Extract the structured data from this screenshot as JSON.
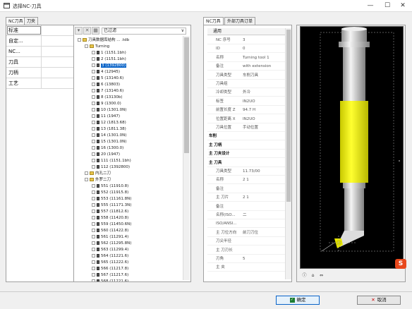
{
  "window": {
    "title": "选择NC-刀具",
    "minimize": "—",
    "maximize": "☐",
    "close": "✕"
  },
  "left_tabs": [
    "NC刀具",
    "刀夹"
  ],
  "left_list": [
    "标准",
    "自定...",
    "NC...",
    "刀具",
    "刀柄",
    "工艺"
  ],
  "tree_toolbar": {
    "filter_label": "已过滤"
  },
  "tree": [
    {
      "label": "刀具数据库结构 ... .tdb",
      "level": 0,
      "icon": "folder"
    },
    {
      "label": "Turning",
      "level": 1,
      "icon": "folder"
    },
    {
      "label": "1 (1151.1bh)",
      "level": 2,
      "icon": "tool"
    },
    {
      "label": "2 (1151.1bh)",
      "level": 2,
      "icon": "tool"
    },
    {
      "label": "3 (1392800)",
      "level": 2,
      "icon": "tool",
      "selected": true
    },
    {
      "label": "4 (12945)",
      "level": 2,
      "icon": "tool"
    },
    {
      "label": "5 (13140.6)",
      "level": 2,
      "icon": "tool"
    },
    {
      "label": "6 (13803)",
      "level": 2,
      "icon": "tool"
    },
    {
      "label": "7 (13140.6)",
      "level": 2,
      "icon": "tool"
    },
    {
      "label": "8 (13130b)",
      "level": 2,
      "icon": "tool"
    },
    {
      "label": "9 (1300.0)",
      "level": 2,
      "icon": "tool"
    },
    {
      "label": "10 (1301.0N)",
      "level": 2,
      "icon": "tool"
    },
    {
      "label": "11 (1947)",
      "level": 2,
      "icon": "tool"
    },
    {
      "label": "12 (1813.68)",
      "level": 2,
      "icon": "tool"
    },
    {
      "label": "13 (1811.38)",
      "level": 2,
      "icon": "tool"
    },
    {
      "label": "14 (1301.0N)",
      "level": 2,
      "icon": "tool"
    },
    {
      "label": "15 (1301.0N)",
      "level": 2,
      "icon": "tool"
    },
    {
      "label": "16 (1300.0)",
      "level": 2,
      "icon": "tool"
    },
    {
      "label": "20 (1947)",
      "level": 2,
      "icon": "tool"
    },
    {
      "label": "111 (1151.1bh)",
      "level": 2,
      "icon": "tool"
    },
    {
      "label": "112 (1392800)",
      "level": 2,
      "icon": "tool"
    },
    {
      "label": "内孔二刀",
      "level": 1,
      "icon": "folder"
    },
    {
      "label": "外罗二刀",
      "level": 1,
      "icon": "folder"
    },
    {
      "label": "551 (11910.8)",
      "level": 2,
      "icon": "tool"
    },
    {
      "label": "552 (11915.8)",
      "level": 2,
      "icon": "tool"
    },
    {
      "label": "553 (11161.8N)",
      "level": 2,
      "icon": "tool"
    },
    {
      "label": "555 (11171.3N)",
      "level": 2,
      "icon": "tool"
    },
    {
      "label": "557 (11812.6)",
      "level": 2,
      "icon": "tool"
    },
    {
      "label": "558 (11420.8)",
      "level": 2,
      "icon": "tool"
    },
    {
      "label": "559 (11450.6N)",
      "level": 2,
      "icon": "tool"
    },
    {
      "label": "560 (11422.8)",
      "level": 2,
      "icon": "tool"
    },
    {
      "label": "561 (11291.4)",
      "level": 2,
      "icon": "tool"
    },
    {
      "label": "562 (11295.8N)",
      "level": 2,
      "icon": "tool"
    },
    {
      "label": "563 (11299.4)",
      "level": 2,
      "icon": "tool"
    },
    {
      "label": "564 (11221.6)",
      "level": 2,
      "icon": "tool"
    },
    {
      "label": "565 (11222.6)",
      "level": 2,
      "icon": "tool"
    },
    {
      "label": "566 (11217.8)",
      "level": 2,
      "icon": "tool"
    },
    {
      "label": "567 (11217.6)",
      "level": 2,
      "icon": "tool"
    },
    {
      "label": "568 (11221.6)",
      "level": 2,
      "icon": "tool"
    }
  ],
  "right_tabs": [
    "NC刀具",
    "外部刀具订单"
  ],
  "props": {
    "header": "通用",
    "rows": [
      {
        "k": "NC 序号",
        "v": "3"
      },
      {
        "k": "ID",
        "v": "0"
      },
      {
        "k": "名称",
        "v": "Turning tool 1"
      },
      {
        "k": "备注",
        "v": "with extension"
      },
      {
        "k": "刀具类型",
        "v": "车削刀具"
      },
      {
        "k": "刀具组",
        "v": ""
      },
      {
        "k": "冷却类型",
        "v": "外冷"
      },
      {
        "k": "标签",
        "v": "IN2UO"
      },
      {
        "k": "前置长度 Z",
        "v": "94.7 H"
      },
      {
        "k": "位置距离 X",
        "v": "IN2UO"
      },
      {
        "k": "刀具位置",
        "v": "手动位置"
      },
      {
        "k": "车削",
        "v": "",
        "section": true
      },
      {
        "k": "主 刀柄",
        "v": "",
        "section": true
      },
      {
        "k": "主 刀夹设计",
        "v": "",
        "section": true
      },
      {
        "k": "主 刀具",
        "v": "",
        "section": true
      },
      {
        "k": "刀具类型",
        "v": "11.73/00"
      },
      {
        "k": "名称",
        "v": "2 1"
      },
      {
        "k": "备注",
        "v": ""
      },
      {
        "k": "主 刀片",
        "v": "2 1"
      },
      {
        "k": "备注",
        "v": ""
      },
      {
        "k": "名称(ISO...",
        "v": "二"
      },
      {
        "k": "ISO/ANSI...",
        "v": ""
      },
      {
        "k": "主 刀位方向",
        "v": "前刀刀位"
      },
      {
        "k": "刀尖半径",
        "v": ""
      },
      {
        "k": "主 刀刃长",
        "v": ""
      },
      {
        "k": "刃角",
        "v": "5"
      },
      {
        "k": "主 夹",
        "v": ""
      }
    ]
  },
  "preview_icons": [
    "ⓘ",
    "⌂",
    "⇔"
  ],
  "buttons": {
    "ok": "确定",
    "cancel": "取消"
  },
  "watermark": "S",
  "colors": {
    "tool_body": "#ffff00",
    "shank": "#e0e0e0",
    "insert_tip": "#e8e800",
    "selection": "#0a64c8"
  }
}
